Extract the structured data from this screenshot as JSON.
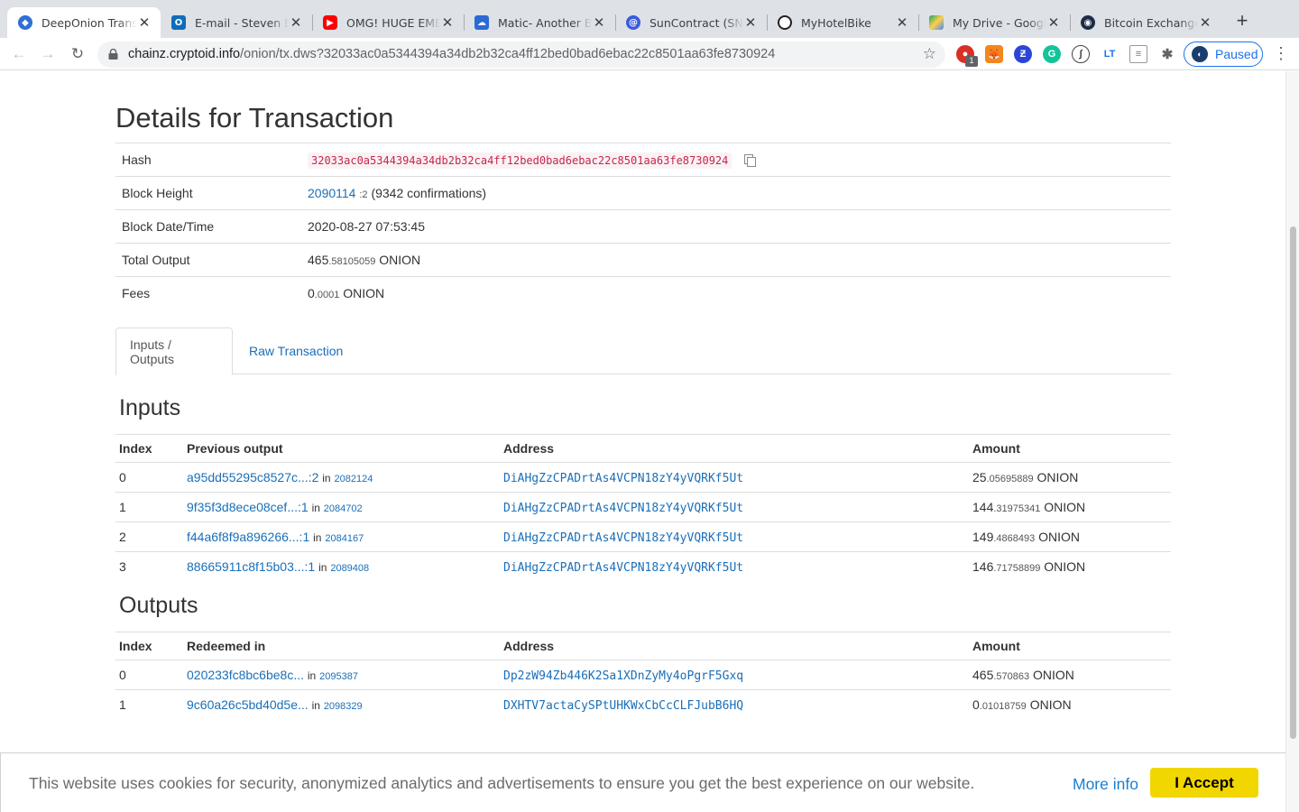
{
  "browser": {
    "tabs": [
      {
        "title": "DeepOnion Transa",
        "icon": "deeponion-icon",
        "color": "#2f6fd6",
        "active": true
      },
      {
        "title": "E-mail - Steven Be",
        "icon": "outlook-icon",
        "color": "#0f6cbd",
        "active": false
      },
      {
        "title": "OMG! HUGE EMER",
        "icon": "youtube-icon",
        "color": "#ff0000",
        "active": false
      },
      {
        "title": "Matic- Another Be",
        "icon": "matic-icon",
        "color": "#2a6ad6",
        "active": false
      },
      {
        "title": "SunContract (SNC",
        "icon": "suncontract-icon",
        "color": "#3b5bdb",
        "active": false
      },
      {
        "title": "MyHotelBike",
        "icon": "myhotelbike-icon",
        "color": "#222222",
        "active": false
      },
      {
        "title": "My Drive - Google",
        "icon": "google-drive-icon",
        "color": "#1fa463",
        "active": false
      },
      {
        "title": "Bitcoin Exchange",
        "icon": "bitcoin-exchange-icon",
        "color": "#1c2c44",
        "active": false
      }
    ],
    "url_host": "chainz.cryptoid.info",
    "url_path": "/onion/tx.dws?32033ac0a5344394a34db2b32ca4ff12bed0bad6ebac22c8501aa63fe8730924",
    "profile_status": "Paused",
    "extension_badge": "1"
  },
  "page": {
    "title": "Details for Transaction",
    "details": {
      "hash_label": "Hash",
      "hash_value": "32033ac0a5344394a34db2b32ca4ff12bed0bad6ebac22c8501aa63fe8730924",
      "block_height_label": "Block Height",
      "block_height": "2090114",
      "block_height_suffix": ":2",
      "confirmations": "(9342 confirmations)",
      "datetime_label": "Block Date/Time",
      "datetime": "2020-08-27 07:53:45",
      "total_output_label": "Total Output",
      "total_output_int": "465",
      "total_output_dec": ".58105059",
      "fees_label": "Fees",
      "fees_int": "0",
      "fees_dec": ".0001",
      "unit": "ONION"
    },
    "tabs": {
      "io": "Inputs / Outputs",
      "raw": "Raw Transaction"
    },
    "inputs": {
      "title": "Inputs",
      "headers": [
        "Index",
        "Previous output",
        "Address",
        "Amount"
      ],
      "rows": [
        {
          "index": "0",
          "prev": "a95dd55295c8527c...:2",
          "in": "in",
          "block": "2082124",
          "address": "DiAHgZzCPADrtAs4VCPN18zY4yVQRKf5Ut",
          "amt_int": "25",
          "amt_dec": ".05695889",
          "unit": "ONION"
        },
        {
          "index": "1",
          "prev": "9f35f3d8ece08cef...:1",
          "in": "in",
          "block": "2084702",
          "address": "DiAHgZzCPADrtAs4VCPN18zY4yVQRKf5Ut",
          "amt_int": "144",
          "amt_dec": ".31975341",
          "unit": "ONION"
        },
        {
          "index": "2",
          "prev": "f44a6f8f9a896266...:1",
          "in": "in",
          "block": "2084167",
          "address": "DiAHgZzCPADrtAs4VCPN18zY4yVQRKf5Ut",
          "amt_int": "149",
          "amt_dec": ".4868493",
          "unit": "ONION"
        },
        {
          "index": "3",
          "prev": "88665911c8f15b03...:1",
          "in": "in",
          "block": "2089408",
          "address": "DiAHgZzCPADrtAs4VCPN18zY4yVQRKf5Ut",
          "amt_int": "146",
          "amt_dec": ".71758899",
          "unit": "ONION"
        }
      ]
    },
    "outputs": {
      "title": "Outputs",
      "headers": [
        "Index",
        "Redeemed in",
        "Address",
        "Amount"
      ],
      "rows": [
        {
          "index": "0",
          "redeemed": "020233fc8bc6be8c...",
          "in": "in",
          "block": "2095387",
          "address": "Dp2zW94Zb446K2Sa1XDnZyMy4oPgrF5Gxq",
          "amt_int": "465",
          "amt_dec": ".570863",
          "unit": "ONION"
        },
        {
          "index": "1",
          "redeemed": "9c60a26c5bd40d5e...",
          "in": "in",
          "block": "2098329",
          "address": "DXHTV7actaCySPtUHKWxCbCcCLFJubB6HQ",
          "amt_int": "0",
          "amt_dec": ".01018759",
          "unit": "ONION"
        }
      ]
    }
  },
  "cookie": {
    "text": "This website uses cookies for security, anonymized analytics and advertisements to ensure you get the best experience on our website.",
    "more_info": "More info",
    "accept": "I Accept"
  }
}
